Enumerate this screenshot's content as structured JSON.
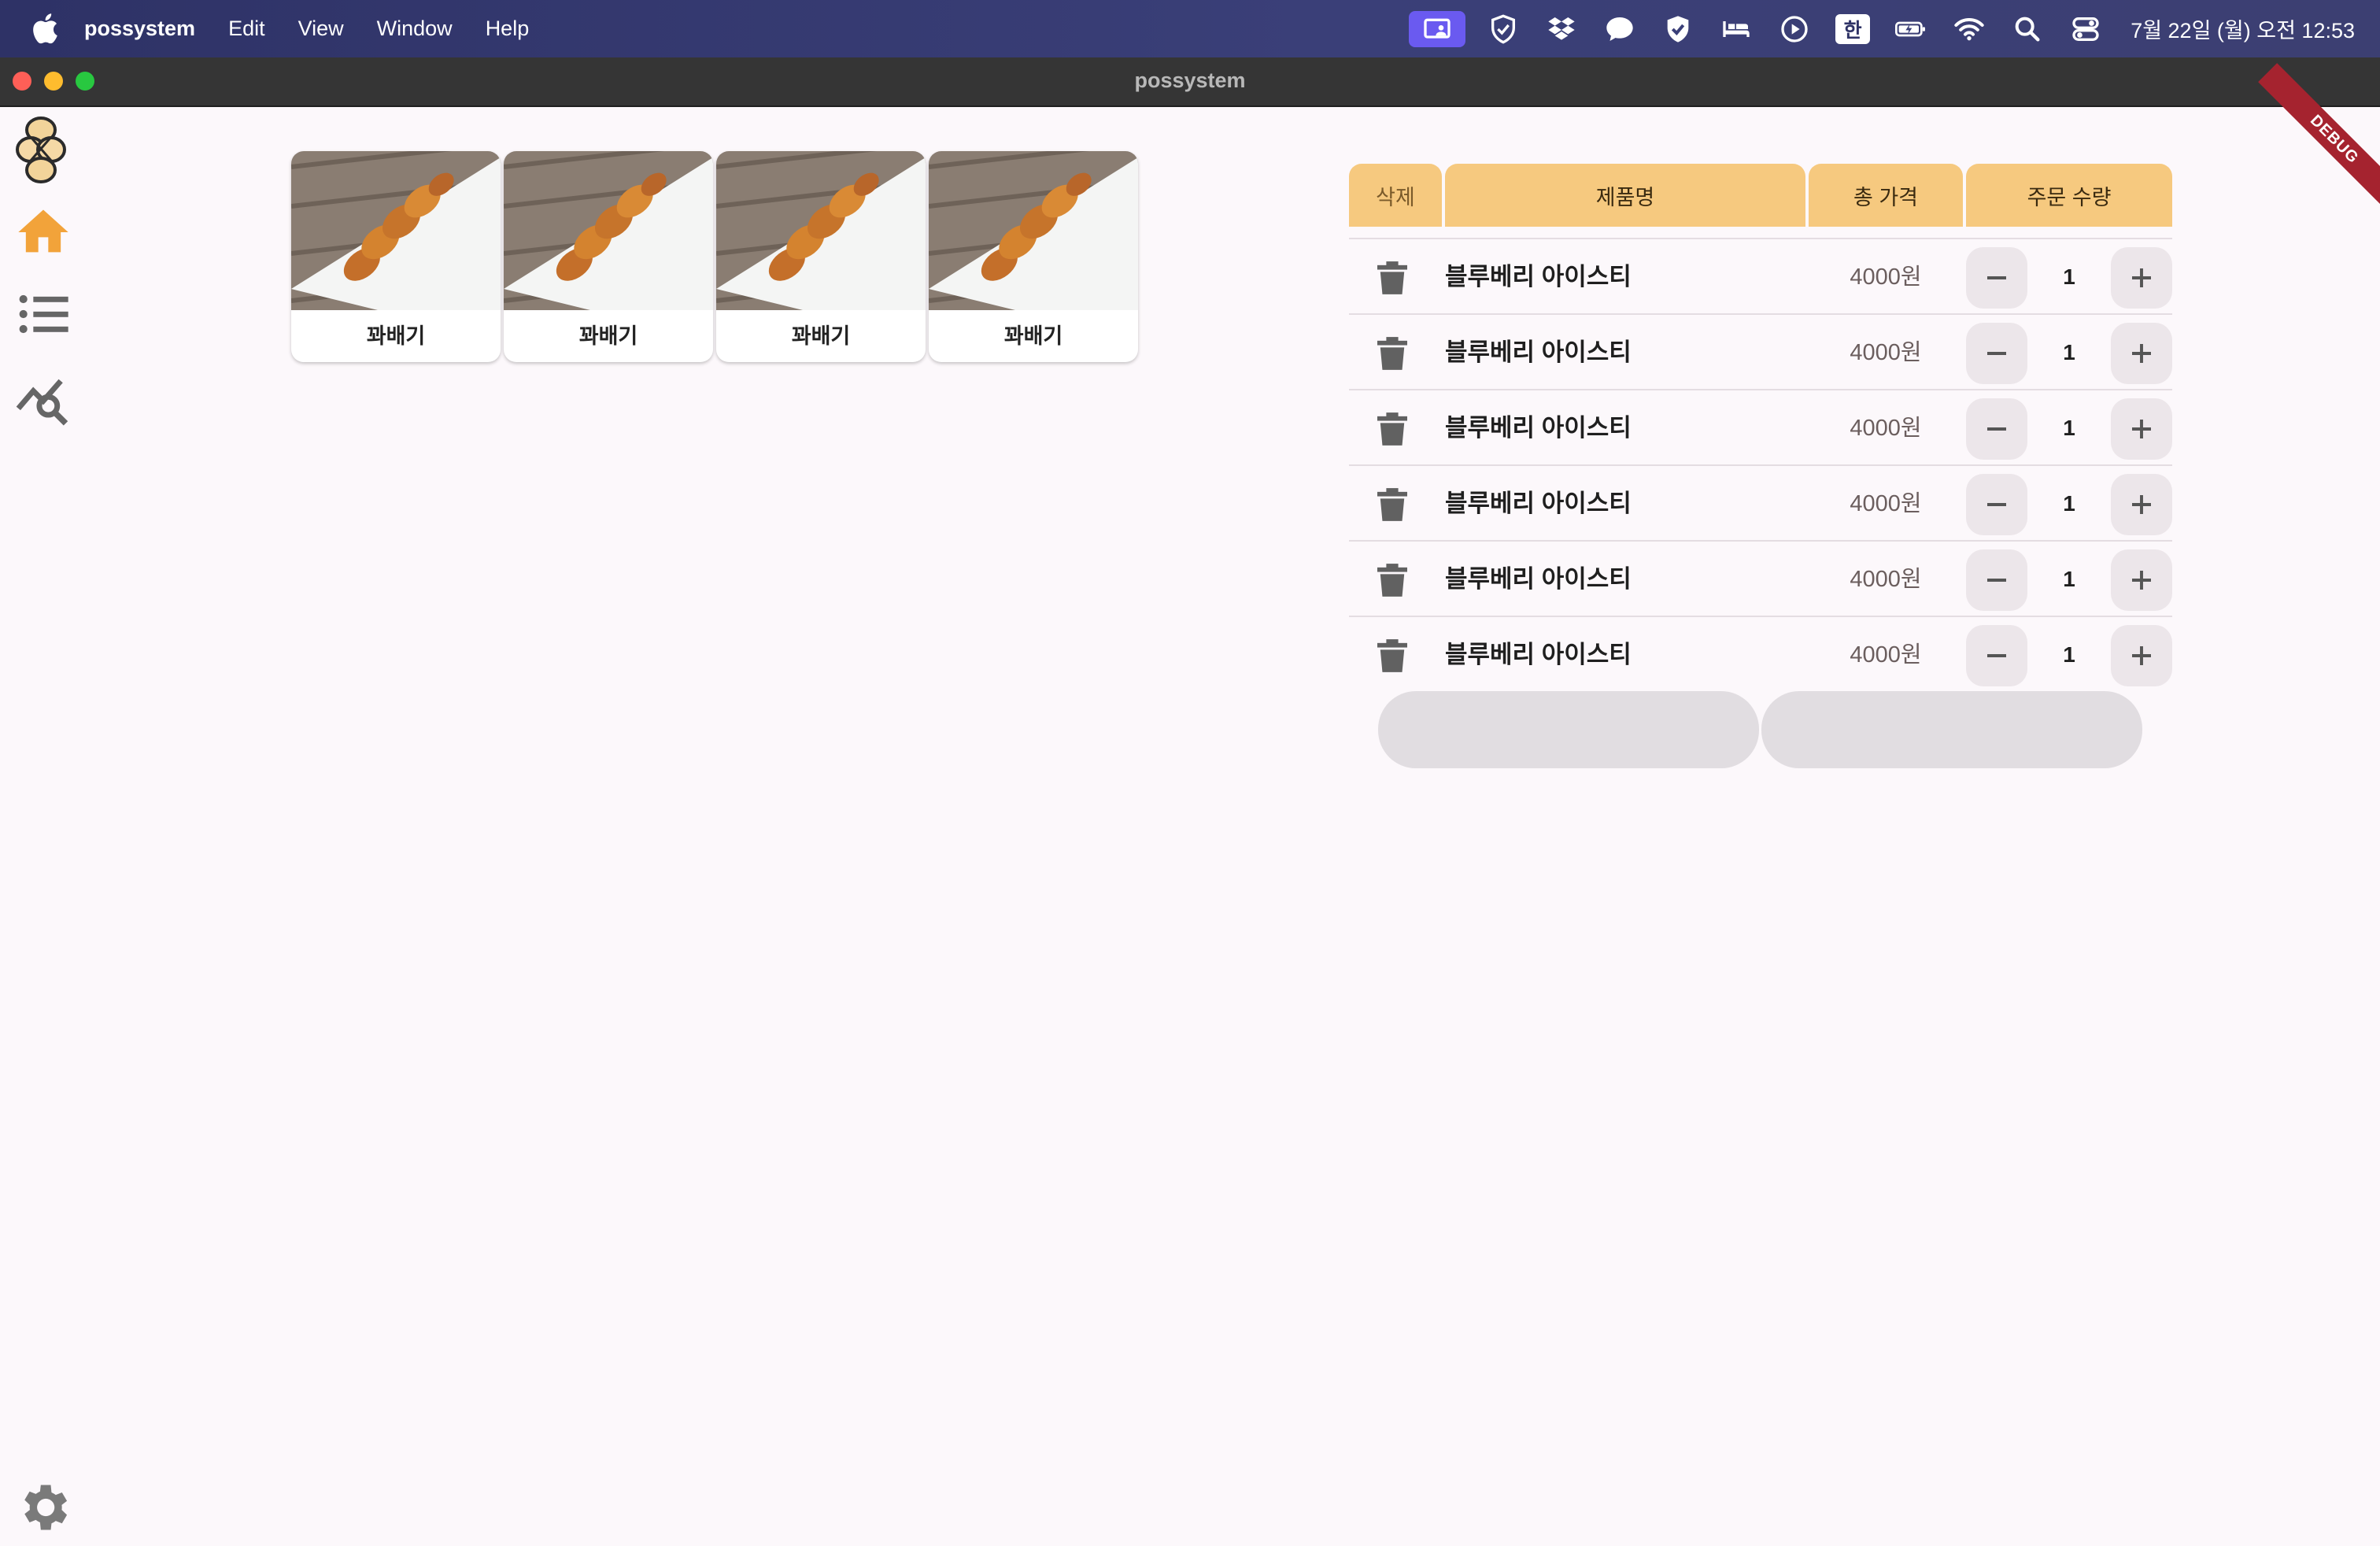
{
  "menubar": {
    "app_name": "possystem",
    "items": [
      "Edit",
      "View",
      "Window",
      "Help"
    ],
    "status_icons": [
      "screen-share-icon",
      "shield-icon",
      "dropbox-icon",
      "chat-bubble-icon",
      "vpn-shield-icon",
      "bed-icon",
      "play-circle-icon",
      "input-source-icon",
      "battery-icon",
      "wifi-icon",
      "spotlight-search-icon",
      "control-center-icon"
    ],
    "input_source": "한",
    "clock": "7월 22일 (월) 오전 12:53"
  },
  "window": {
    "title": "possystem"
  },
  "debug_banner": "DEBUG",
  "products": [
    {
      "label": "꽈배기"
    },
    {
      "label": "꽈배기"
    },
    {
      "label": "꽈배기"
    },
    {
      "label": "꽈배기"
    }
  ],
  "order_table": {
    "headers": {
      "delete": "삭제",
      "name": "제품명",
      "total": "총 가격",
      "quantity": "주문 수량"
    },
    "rows": [
      {
        "name": "블루베리 아이스티",
        "price": "4000원",
        "qty": "1"
      },
      {
        "name": "블루베리 아이스티",
        "price": "4000원",
        "qty": "1"
      },
      {
        "name": "블루베리 아이스티",
        "price": "4000원",
        "qty": "1"
      },
      {
        "name": "블루베리 아이스티",
        "price": "4000원",
        "qty": "1"
      },
      {
        "name": "블루베리 아이스티",
        "price": "4000원",
        "qty": "1"
      },
      {
        "name": "블루베리 아이스티",
        "price": "4000원",
        "qty": "1"
      }
    ]
  },
  "colors": {
    "accent": "#f6c97f",
    "home_icon": "#f2a33a",
    "nav_icon": "#666666"
  }
}
